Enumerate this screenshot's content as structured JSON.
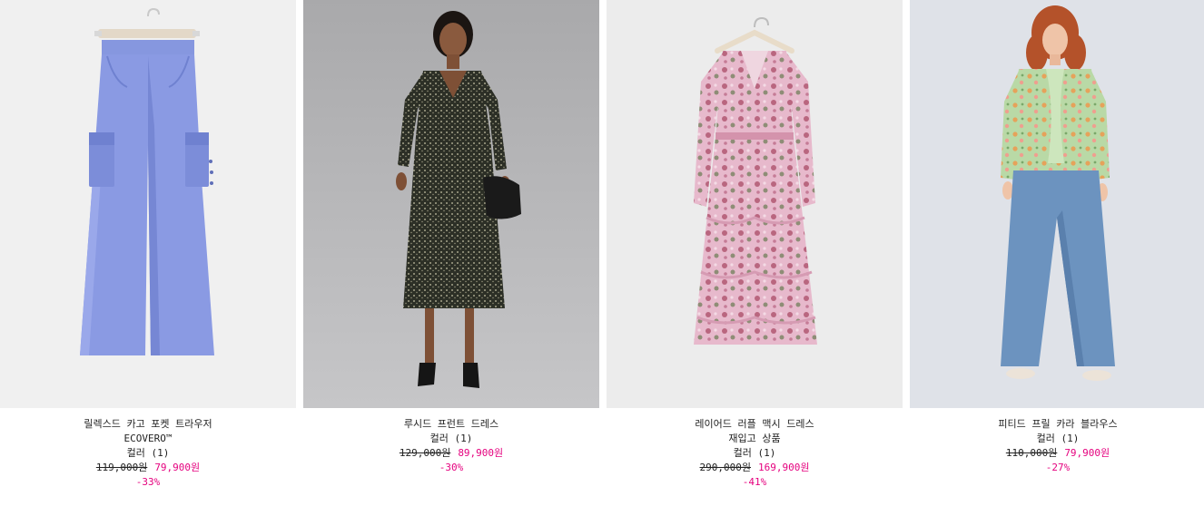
{
  "accent_sale_color": "#e5007e",
  "products": [
    {
      "title": "릴렉스드 카고 포켓 트라우저",
      "subtitle": "ECOVERO™",
      "colors_label": "컬러 (1)",
      "original_price": "119,000원",
      "sale_price": "79,900원",
      "discount": "-33%",
      "image_icon": "blue-cargo-trousers-image",
      "bg_color": "#f0f0f0"
    },
    {
      "title": "루시드 프런트 드레스",
      "subtitle": "",
      "colors_label": "컬러 (1)",
      "original_price": "129,000원",
      "sale_price": "89,900원",
      "discount": "-30%",
      "image_icon": "floral-ruched-dress-model-image",
      "bg_color": "#b9b9bb"
    },
    {
      "title": "레이어드 러플 맥시 드레스",
      "subtitle": "재입고 상품",
      "colors_label": "컬러 (1)",
      "original_price": "290,000원",
      "sale_price": "169,900원",
      "discount": "-41%",
      "image_icon": "pink-ruffle-dress-hanger-image",
      "bg_color": "#ececec"
    },
    {
      "title": "피티드 프릴 카라 블라우스",
      "subtitle": "",
      "colors_label": "컬러 (1)",
      "original_price": "110,000원",
      "sale_price": "79,900원",
      "discount": "-27%",
      "image_icon": "green-floral-blouse-model-image",
      "bg_color": "#dfe2e8"
    }
  ]
}
